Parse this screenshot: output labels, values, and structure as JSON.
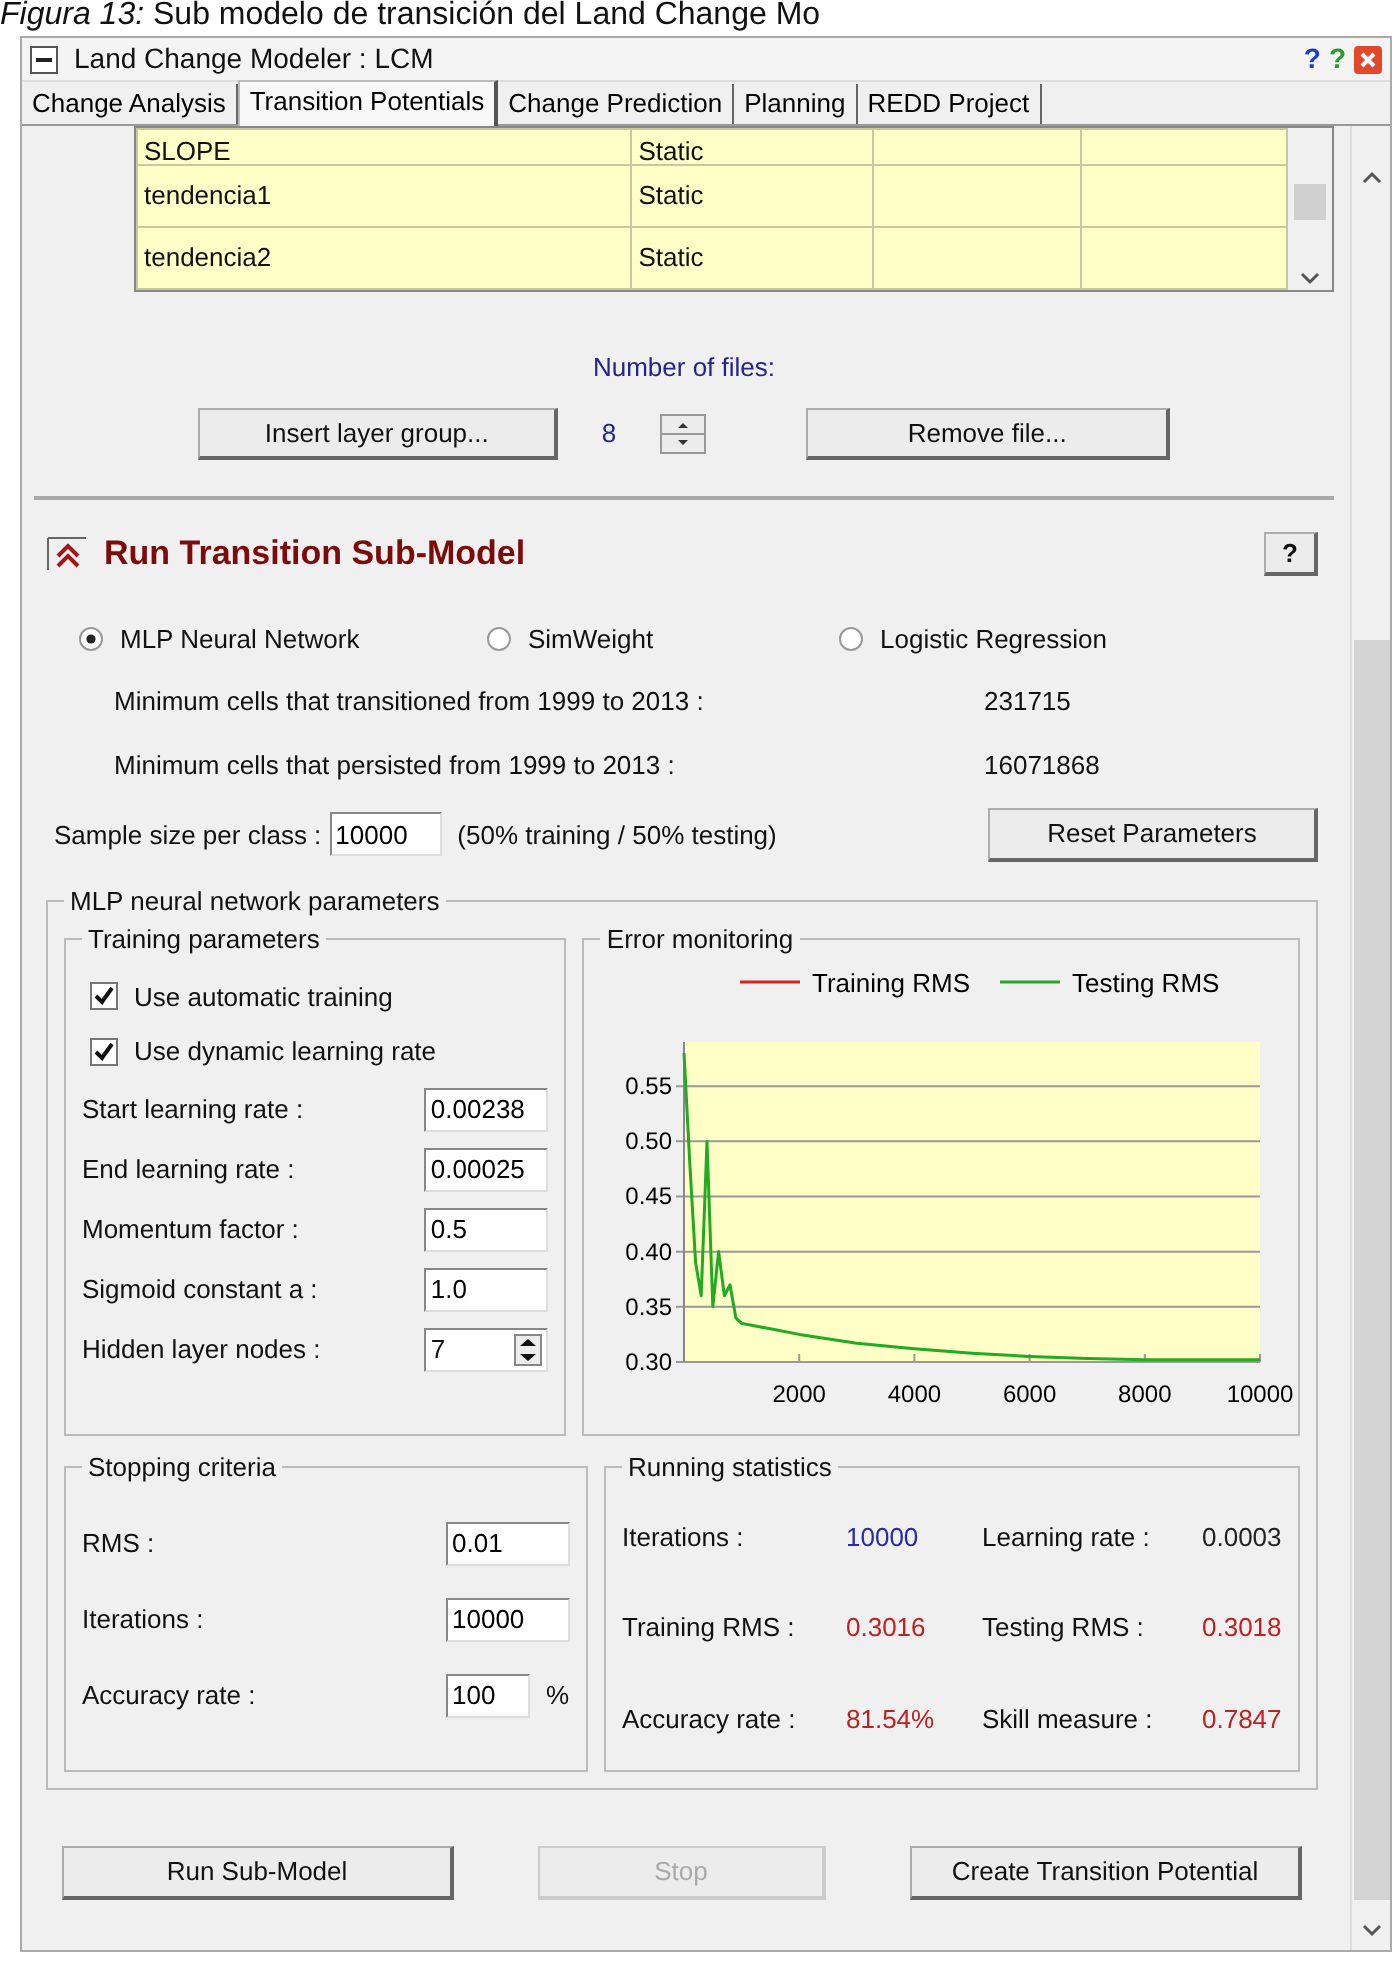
{
  "caption": "*Figura 13:* Sub modelo de transición del Land Change Mo",
  "window": {
    "title": "Land Change Modeler : LCM",
    "help_buttons": [
      "?",
      "?"
    ]
  },
  "tabs": [
    {
      "label": "Change Analysis",
      "selected": false
    },
    {
      "label": "Transition Potentials",
      "selected": true
    },
    {
      "label": "Change Prediction",
      "selected": false
    },
    {
      "label": "Planning",
      "selected": false
    },
    {
      "label": "REDD Project",
      "selected": false
    }
  ],
  "layers": {
    "rows": [
      {
        "column_1": "SLOPE",
        "column_2": "Static"
      },
      {
        "column_1": "tendencia1",
        "column_2": "Static"
      },
      {
        "column_1": "tendencia2",
        "column_2": "Static"
      }
    ]
  },
  "files": {
    "label": "Number of files:",
    "count": "8",
    "insert_button": "Insert layer group...",
    "remove_button": "Remove file..."
  },
  "submodel": {
    "title": "Run Transition Sub-Model",
    "expanded": true,
    "help": "?",
    "methods": [
      {
        "label": "MLP Neural Network",
        "selected": true
      },
      {
        "label": "SimWeight",
        "selected": false
      },
      {
        "label": "Logistic Regression",
        "selected": false
      }
    ],
    "cells": [
      {
        "label": "Minimum cells that transitioned from 1999 to 2013 :",
        "value": "231715"
      },
      {
        "label": "Minimum cells that persisted from 1999 to 2013 :",
        "value": "16071868"
      }
    ],
    "sample": {
      "label": "Sample size per class :",
      "value": "10000",
      "note": "(50% training / 50% testing)"
    },
    "reset_button": "Reset Parameters"
  },
  "mlp": {
    "title": "MLP neural network parameters",
    "training": {
      "title": "Training parameters",
      "options": [
        {
          "label": "Use automatic training",
          "checked": true
        },
        {
          "label": "Use dynamic learning rate",
          "checked": true
        }
      ],
      "fields": [
        {
          "label": "Start learning rate :",
          "value": "0.00238",
          "kind": "text"
        },
        {
          "label": "End learning rate :",
          "value": "0.00025",
          "kind": "text"
        },
        {
          "label": "Momentum factor :",
          "value": "0.5",
          "kind": "text"
        },
        {
          "label": "Sigmoid constant a :",
          "value": "1.0",
          "kind": "text"
        },
        {
          "label": "Hidden layer nodes :",
          "value": "7",
          "kind": "spin"
        }
      ]
    },
    "error": {
      "title": "Error monitoring",
      "chart_data": {
        "type": "line",
        "x": [
          0,
          100,
          200,
          300,
          400,
          500,
          600,
          700,
          800,
          900,
          1000,
          1500,
          2000,
          3000,
          4000,
          5000,
          6000,
          7000,
          8000,
          9000,
          10000
        ],
        "grid": true,
        "legend": true,
        "series": [
          {
            "name": "Training RMS",
            "color": "#e02020",
            "values": [
              null,
              null,
              null,
              null,
              null,
              null,
              null,
              null,
              null,
              null,
              null,
              null,
              null,
              null,
              null,
              null,
              null,
              null,
              null,
              null,
              null
            ]
          },
          {
            "name": "Testing RMS",
            "color": "#22aa22",
            "values": [
              0.58,
              0.48,
              0.39,
              0.36,
              0.5,
              0.35,
              0.4,
              0.36,
              0.37,
              0.34,
              0.335,
              0.33,
              0.325,
              0.317,
              0.312,
              0.308,
              0.305,
              0.303,
              0.302,
              0.302,
              0.302
            ]
          }
        ],
        "xlim": [
          0,
          10000
        ],
        "ylim": [
          0.3,
          0.59
        ],
        "xticks": [
          2000,
          4000,
          6000,
          8000,
          10000
        ],
        "yticks": [
          {
            "value": 0.3,
            "label": "0.30"
          },
          {
            "value": 0.35,
            "label": "0.35"
          },
          {
            "value": 0.4,
            "label": "0.40"
          },
          {
            "value": 0.45,
            "label": "0.45"
          },
          {
            "value": 0.5,
            "label": "0.50"
          },
          {
            "value": 0.55,
            "label": "0.55"
          }
        ]
      }
    },
    "stopping": {
      "title": "Stopping criteria",
      "fields": [
        {
          "label": "RMS :",
          "value": "0.01"
        },
        {
          "label": "Iterations :",
          "value": "10000"
        },
        {
          "label": "Accuracy rate :",
          "value": "100",
          "unit": "%"
        }
      ]
    },
    "running": {
      "title": "Running statistics",
      "stats": [
        {
          "label": "Iterations :",
          "value": "10000",
          "color": "#2a2aa8"
        },
        {
          "label": "Learning rate :",
          "value": "0.0003",
          "color": "#222222"
        },
        {
          "label": "Training RMS :",
          "value": "0.3016",
          "color": "#c02020"
        },
        {
          "label": "Testing RMS :",
          "value": "0.3018",
          "color": "#c02020"
        },
        {
          "label": "Accuracy rate :",
          "value": "81.54%",
          "color": "#c02020"
        },
        {
          "label": "Skill measure :",
          "value": "0.7847",
          "color": "#c02020"
        }
      ]
    }
  },
  "actions": [
    {
      "label": "Run Sub-Model",
      "disabled": false
    },
    {
      "label": "Stop",
      "disabled": true
    },
    {
      "label": "Create Transition Potential",
      "disabled": false
    }
  ]
}
